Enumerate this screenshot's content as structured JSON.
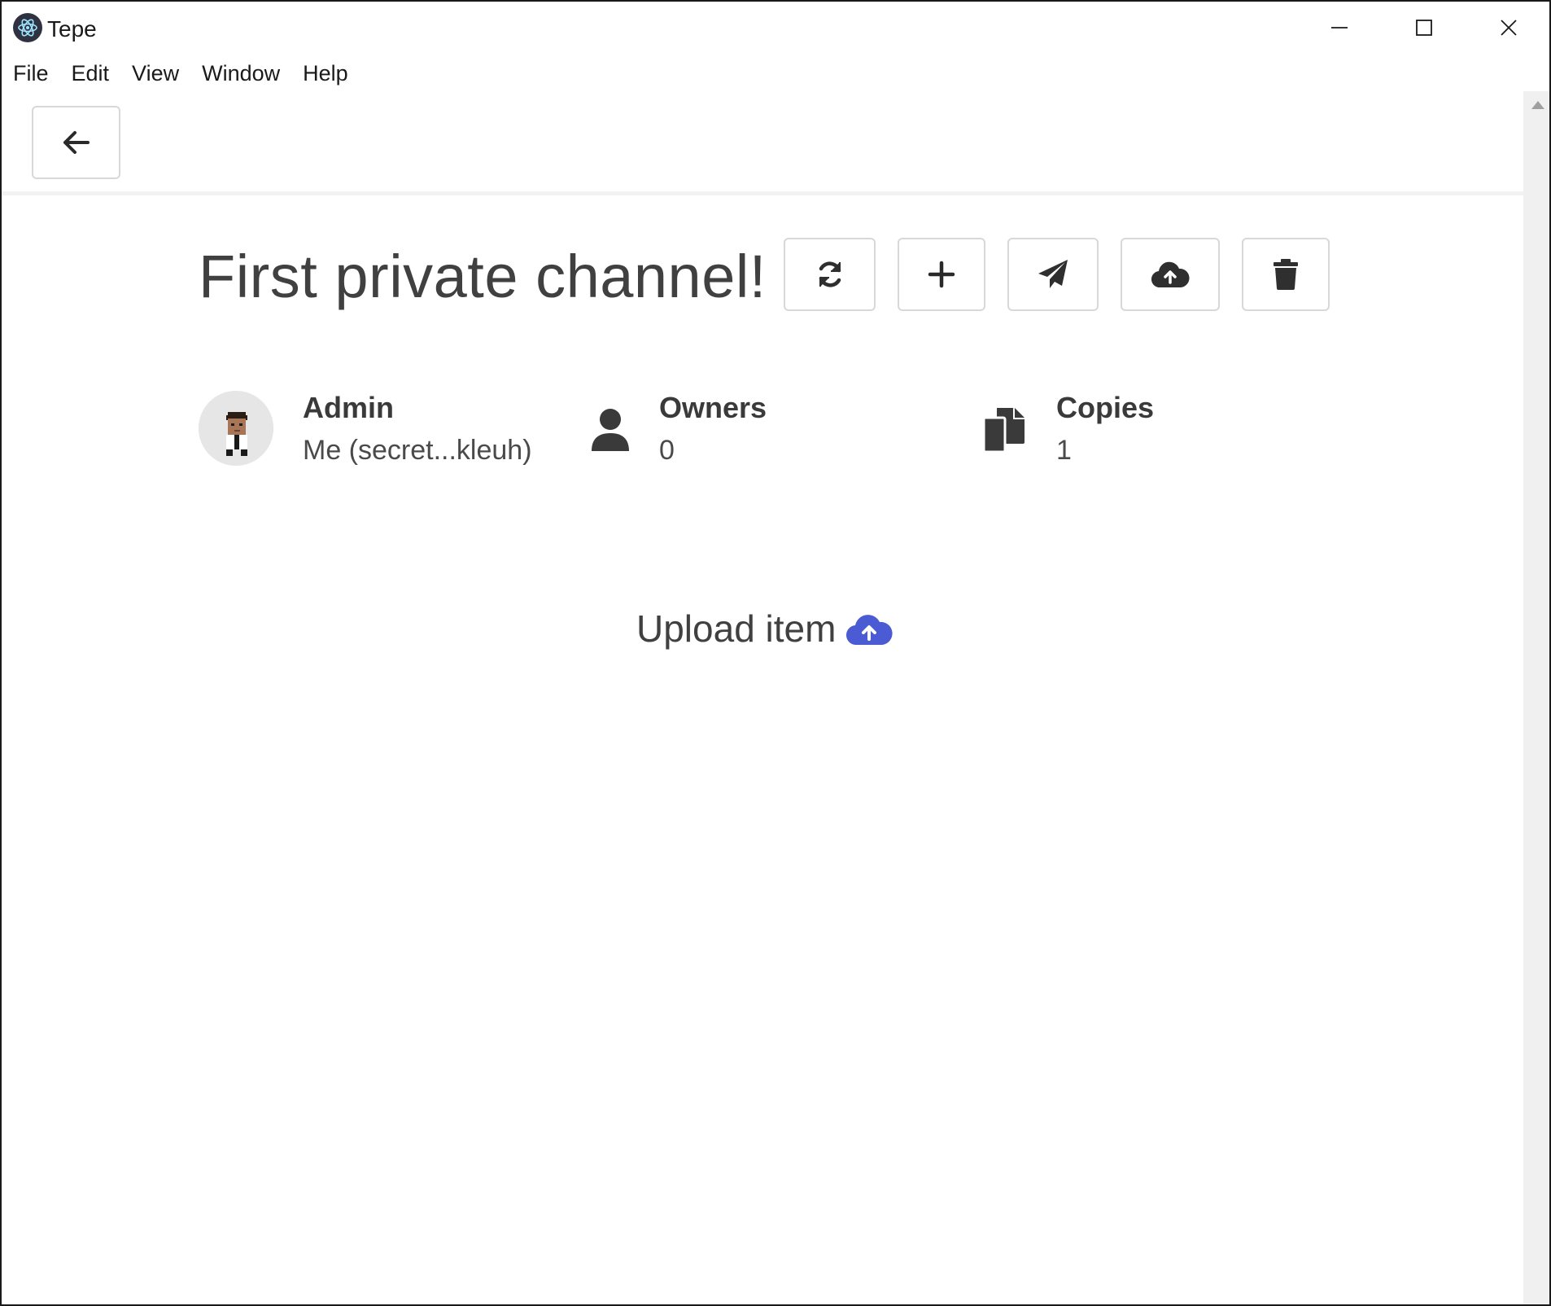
{
  "window": {
    "title": "Tepe"
  },
  "menu": [
    "File",
    "Edit",
    "View",
    "Window",
    "Help"
  ],
  "channel": {
    "title": "First private channel!"
  },
  "admin": {
    "label": "Admin",
    "value": "Me (secret...kleuh)"
  },
  "owners": {
    "label": "Owners",
    "value": "0"
  },
  "copies": {
    "label": "Copies",
    "value": "1"
  },
  "upload": {
    "label": "Upload item"
  },
  "colors": {
    "accent": "#4a5bd4",
    "icon": "#3a3a3a",
    "border": "#d8d8d8"
  }
}
